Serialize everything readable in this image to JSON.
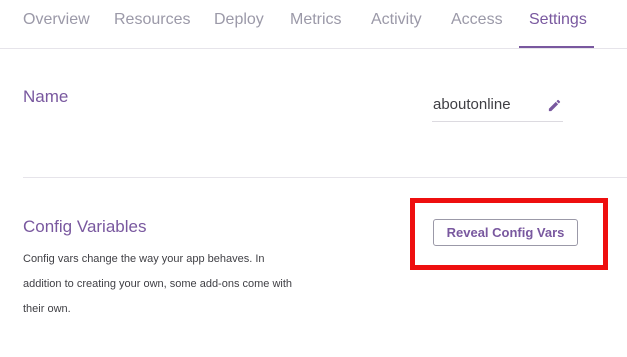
{
  "tabs": [
    {
      "label": "Overview"
    },
    {
      "label": "Resources"
    },
    {
      "label": "Deploy"
    },
    {
      "label": "Metrics"
    },
    {
      "label": "Activity"
    },
    {
      "label": "Access"
    },
    {
      "label": "Settings",
      "active": true
    }
  ],
  "name_section": {
    "title": "Name",
    "value": "aboutonline",
    "edit_icon": "pencil-icon"
  },
  "config_section": {
    "title": "Config Variables",
    "description": "Config vars change the way your app behaves. In addition to creating your own, some add-ons come with their own.",
    "button_label": "Reveal Config Vars"
  },
  "colors": {
    "accent": "#79589f",
    "tab_inactive": "#9b99a8",
    "text": "#3f3f44",
    "border": "#e6e4ea",
    "highlight": "#ee0f0f"
  }
}
